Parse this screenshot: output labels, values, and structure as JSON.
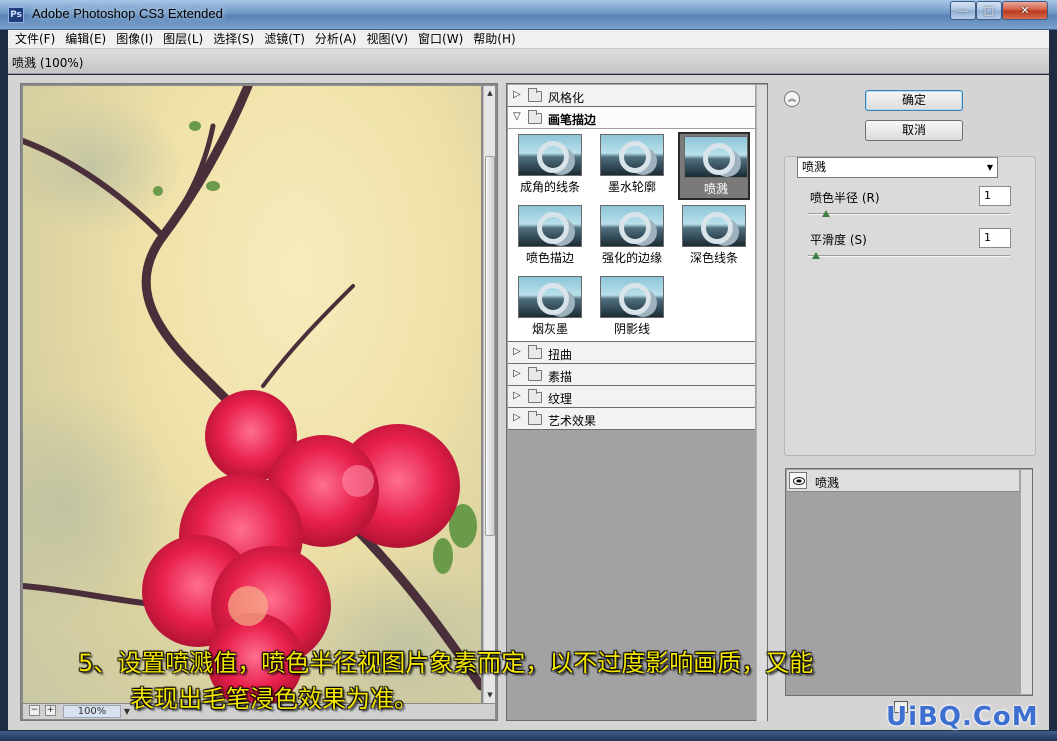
{
  "window": {
    "title": "Adobe Photoshop CS3 Extended",
    "logo": "Ps",
    "controls": {
      "minimize": "—",
      "maximize": "□",
      "close": "✕"
    }
  },
  "menu": [
    "文件(F)",
    "编辑(E)",
    "图像(I)",
    "图层(L)",
    "选择(S)",
    "滤镜(T)",
    "分析(A)",
    "视图(V)",
    "窗口(W)",
    "帮助(H)"
  ],
  "dialog": {
    "title": "喷溅 (100%)"
  },
  "preview": {
    "zoom": "100%",
    "zoom_out": "−",
    "zoom_in": "+"
  },
  "gallery": {
    "folders_before": [
      {
        "label": "风格化"
      }
    ],
    "open_folder": {
      "label": "画笔描边"
    },
    "thumbs": [
      {
        "label": "成角的线条",
        "selected": false
      },
      {
        "label": "墨水轮廓",
        "selected": false
      },
      {
        "label": "喷溅",
        "selected": true
      },
      {
        "label": "喷色描边",
        "selected": false
      },
      {
        "label": "强化的边缘",
        "selected": false
      },
      {
        "label": "深色线条",
        "selected": false
      },
      {
        "label": "烟灰墨",
        "selected": false
      },
      {
        "label": "阴影线",
        "selected": false
      }
    ],
    "folders_after": [
      {
        "label": "扭曲"
      },
      {
        "label": "素描"
      },
      {
        "label": "纹理"
      },
      {
        "label": "艺术效果"
      }
    ]
  },
  "settings": {
    "collapse_icon": "chevron-up-icon",
    "ok_label": "确定",
    "cancel_label": "取消",
    "filter_selected": "喷溅",
    "params": [
      {
        "label": "喷色半径 (R)",
        "value": "1",
        "level": 0.05
      },
      {
        "label": "平滑度 (S)",
        "value": "1",
        "level": 0.0
      }
    ]
  },
  "layers": {
    "items": [
      {
        "name": "喷溅",
        "visible": true
      }
    ]
  },
  "overlay": {
    "caption_line1": "5、设置喷溅值，喷色半径视图片象素而定，以不过度影响画质，又能",
    "caption_line2": "表现出毛笔浸色效果为准。",
    "watermark": "UiBQ.CoM"
  }
}
